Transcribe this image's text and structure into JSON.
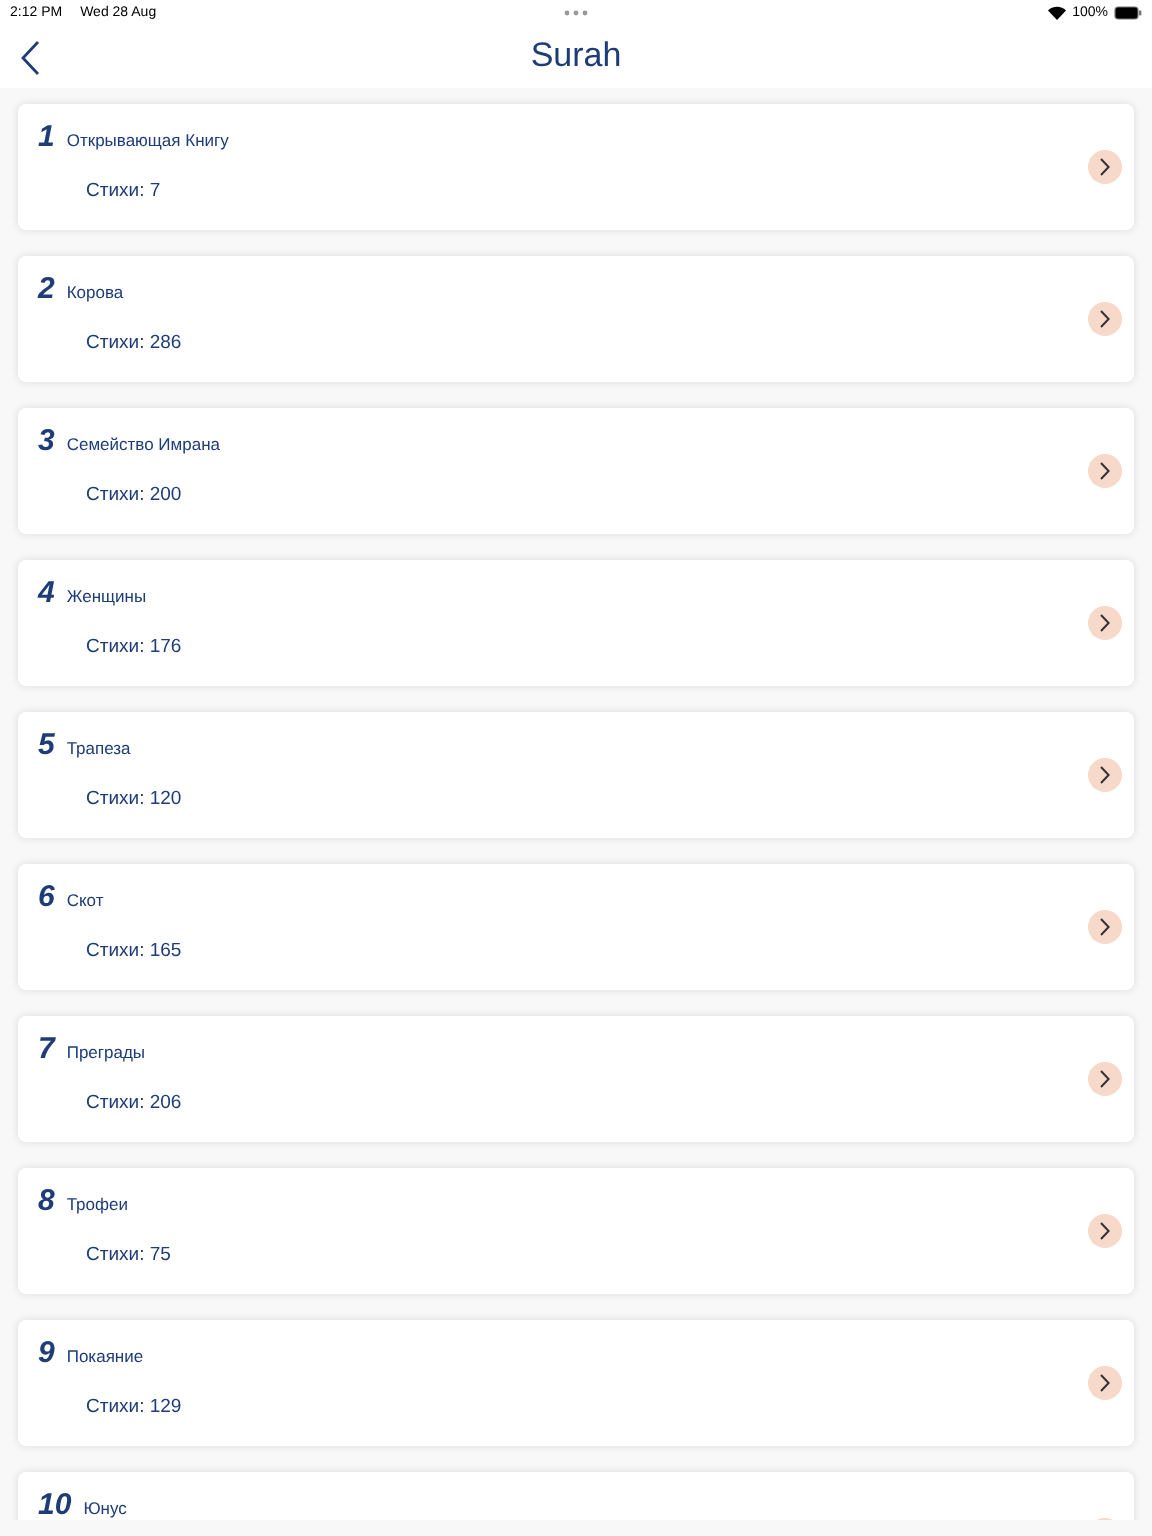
{
  "status_bar": {
    "time": "2:12 PM",
    "date": "Wed 28 Aug",
    "battery": "100%"
  },
  "nav": {
    "title": "Surah"
  },
  "surahs": [
    {
      "number": "1",
      "name": "Открывающая Книгу",
      "verses": "Стихи: 7"
    },
    {
      "number": "2",
      "name": "Корова",
      "verses": "Стихи: 286"
    },
    {
      "number": "3",
      "name": "Семейство Имрана",
      "verses": "Стихи: 200"
    },
    {
      "number": "4",
      "name": "Женщины",
      "verses": "Стихи: 176"
    },
    {
      "number": "5",
      "name": "Трапеза",
      "verses": "Стихи: 120"
    },
    {
      "number": "6",
      "name": "Скот",
      "verses": "Стихи: 165"
    },
    {
      "number": "7",
      "name": "Преграды",
      "verses": "Стихи: 206"
    },
    {
      "number": "8",
      "name": "Трофеи",
      "verses": "Стихи: 75"
    },
    {
      "number": "9",
      "name": "Покаяние",
      "verses": "Стихи: 129"
    },
    {
      "number": "10",
      "name": "Юнус"
    }
  ]
}
